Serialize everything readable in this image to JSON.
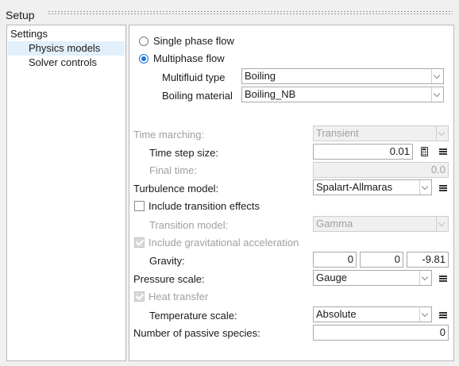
{
  "window": {
    "title": "Setup"
  },
  "tree": {
    "header": "Settings",
    "items": [
      {
        "label": "Physics models",
        "selected": true
      },
      {
        "label": "Solver controls",
        "selected": false
      }
    ]
  },
  "flow": {
    "single_label": "Single phase flow",
    "multi_label": "Multiphase flow",
    "selected": "multiphase",
    "multifluid_type_label": "Multifluid type",
    "multifluid_type_value": "Boiling",
    "boiling_material_label": "Boiling material",
    "boiling_material_value": "Boiling_NB"
  },
  "time": {
    "marching_label": "Time marching:",
    "marching_value": "Transient",
    "step_size_label": "Time step size:",
    "step_size_value": "0.01",
    "final_label": "Final time:",
    "final_value": "0.0"
  },
  "turbulence": {
    "label": "Turbulence model:",
    "value": "Spalart-Allmaras",
    "transition_check_label": "Include transition effects",
    "transition_model_label": "Transition model:",
    "transition_model_value": "Gamma"
  },
  "gravity": {
    "check_label": "Include gravitational acceleration",
    "label": "Gravity:",
    "x": "0",
    "y": "0",
    "z": "-9.81"
  },
  "pressure": {
    "label": "Pressure scale:",
    "value": "Gauge"
  },
  "heat": {
    "check_label": "Heat transfer",
    "temperature_label": "Temperature scale:",
    "temperature_value": "Absolute"
  },
  "species": {
    "label": "Number of passive species:",
    "value": "0"
  },
  "colors": {
    "accent": "#1976d2",
    "selection": "#e1f0fb",
    "disabled_text": "#a0a0a0"
  }
}
